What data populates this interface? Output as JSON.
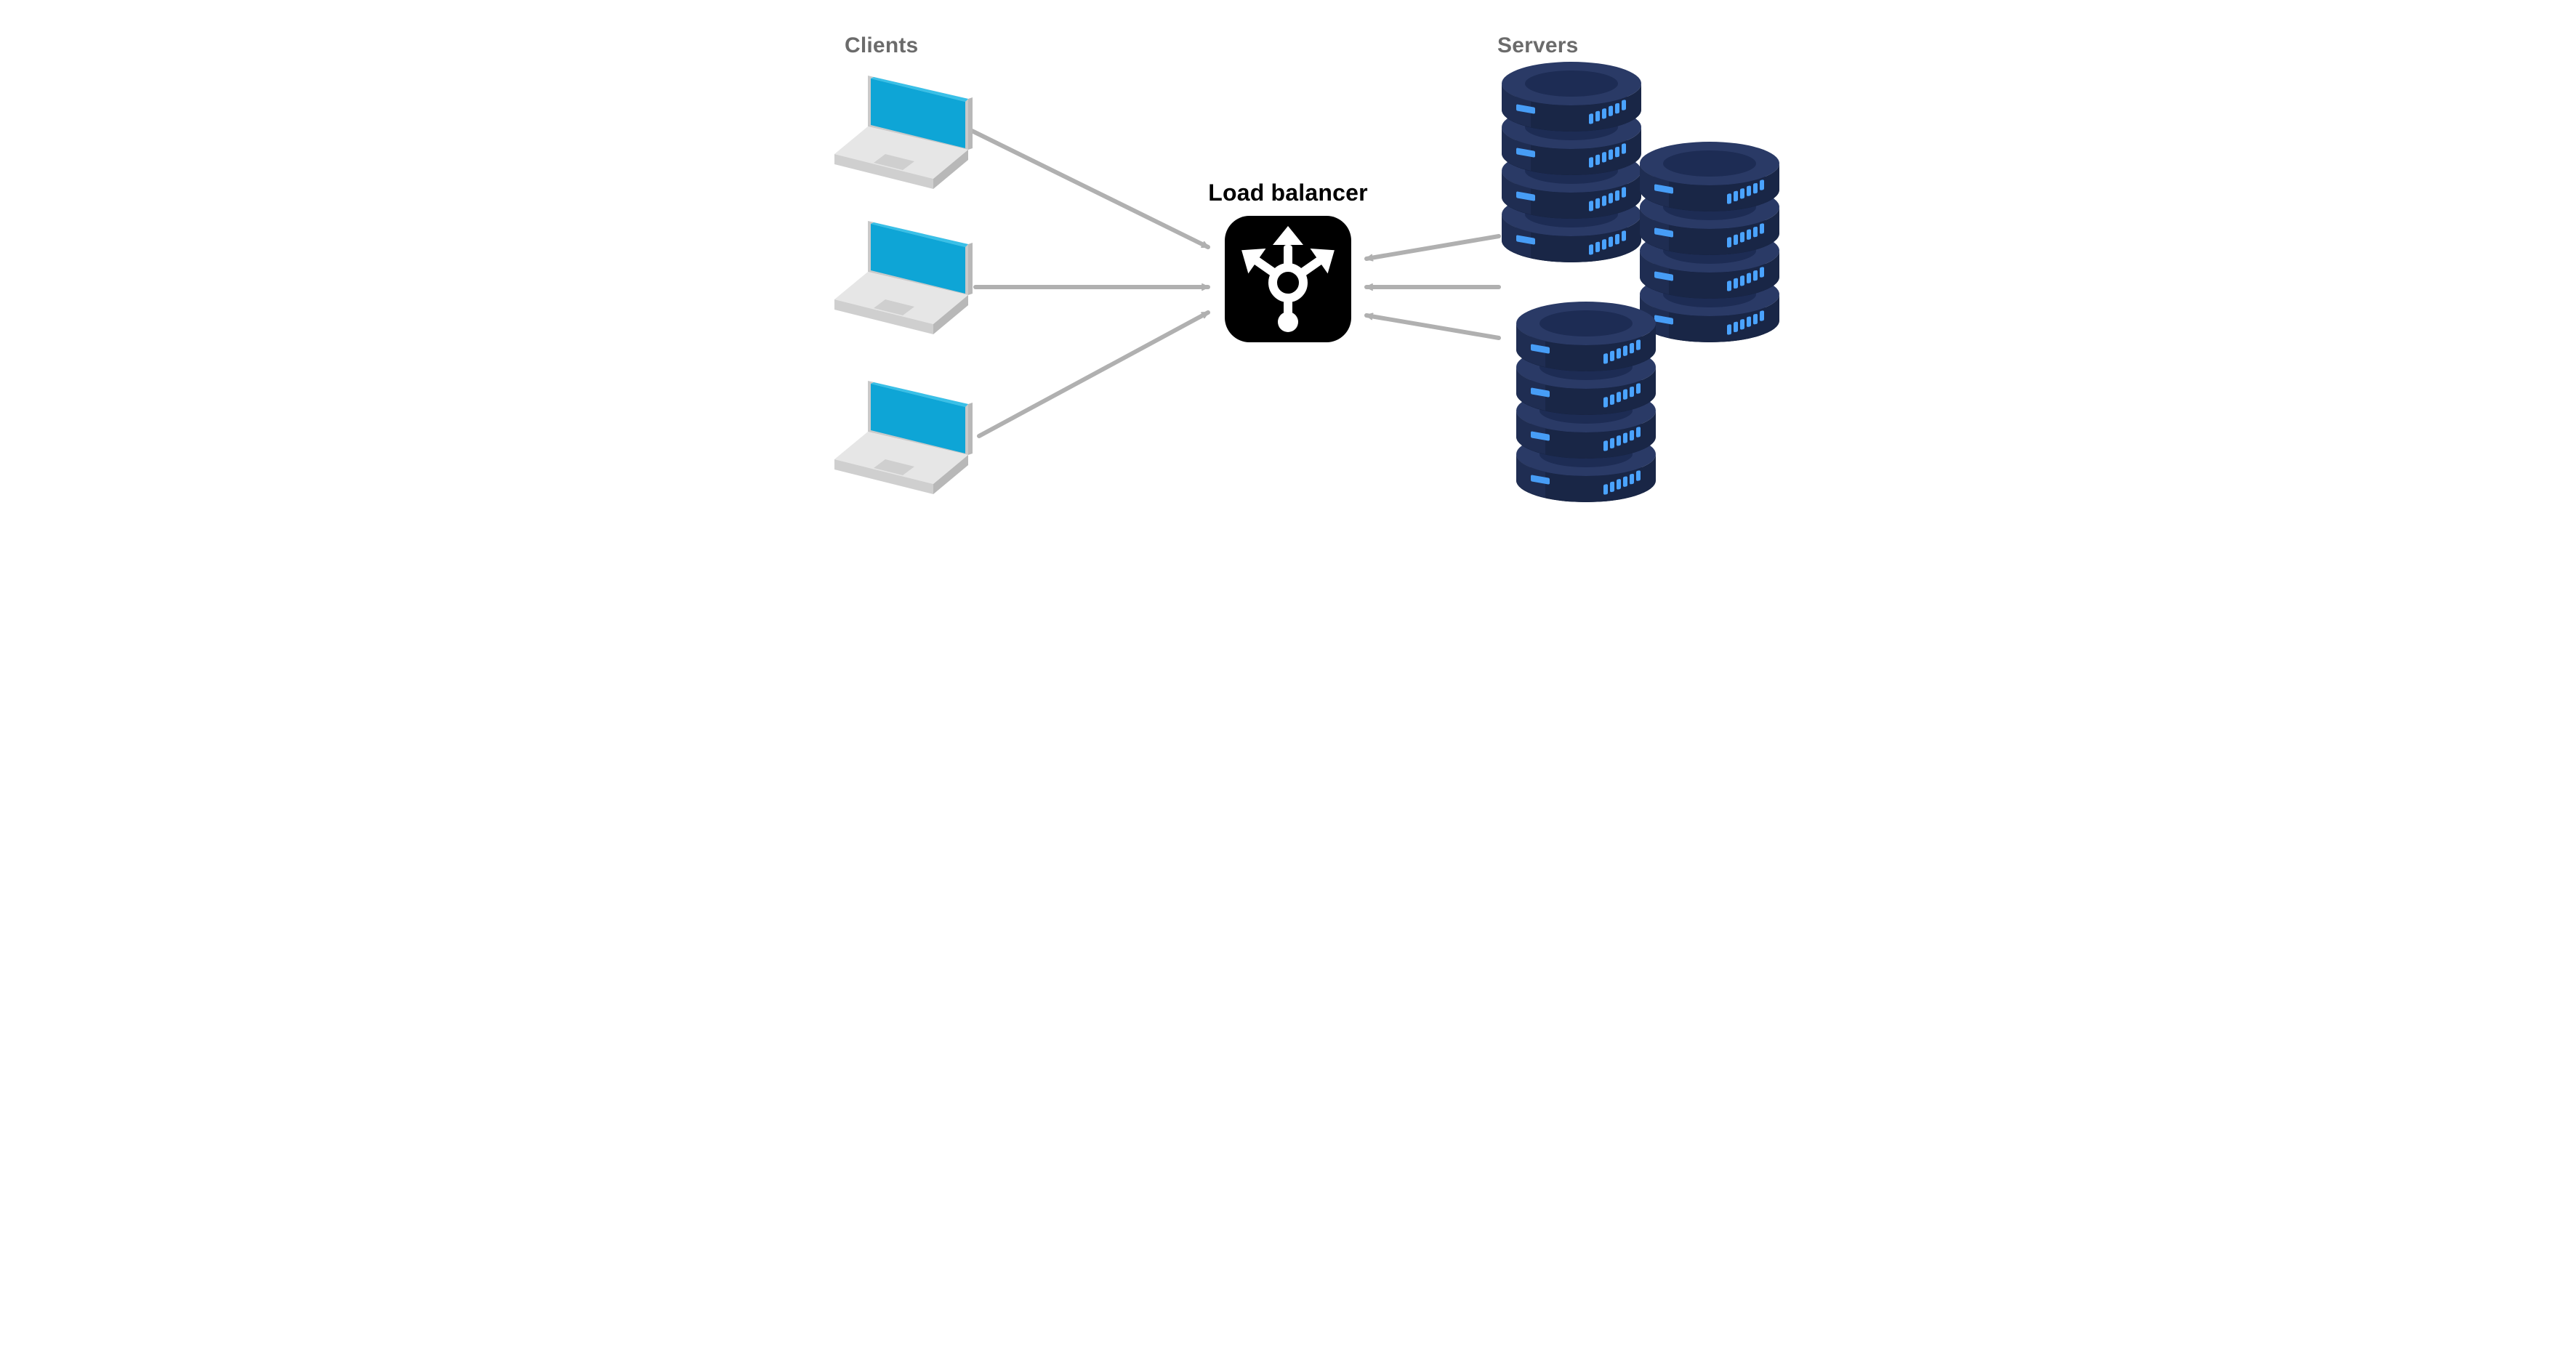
{
  "labels": {
    "clients": "Clients",
    "servers": "Servers",
    "load_balancer": "Load balancer"
  },
  "nodes": {
    "clients": [
      {
        "id": "client-1",
        "type": "laptop"
      },
      {
        "id": "client-2",
        "type": "laptop"
      },
      {
        "id": "client-3",
        "type": "laptop"
      }
    ],
    "servers": [
      {
        "id": "server-stack-1",
        "type": "server-stack"
      },
      {
        "id": "server-stack-2",
        "type": "server-stack"
      },
      {
        "id": "server-stack-3",
        "type": "server-stack"
      }
    ],
    "center": {
      "id": "load-balancer",
      "type": "load-balancer"
    }
  },
  "edges": [
    {
      "from": "client-1",
      "to": "load-balancer"
    },
    {
      "from": "client-2",
      "to": "load-balancer"
    },
    {
      "from": "client-3",
      "to": "load-balancer"
    },
    {
      "from": "server-stack-1",
      "to": "load-balancer"
    },
    {
      "from": "server-stack-2",
      "to": "load-balancer"
    },
    {
      "from": "server-stack-3",
      "to": "load-balancer"
    }
  ],
  "colors": {
    "arrow": "#b0b0b0",
    "laptop_screen": "#0ea5d6",
    "laptop_body_light": "#e6e6e6",
    "laptop_body_mid": "#cfcfcf",
    "laptop_body_dark": "#b8b8b8",
    "server_dark": "#1f2b50",
    "server_darker": "#14203e",
    "server_light": "#33426e",
    "server_led": "#4aa3ff",
    "lb_bg": "#000000",
    "lb_fg": "#ffffff"
  }
}
